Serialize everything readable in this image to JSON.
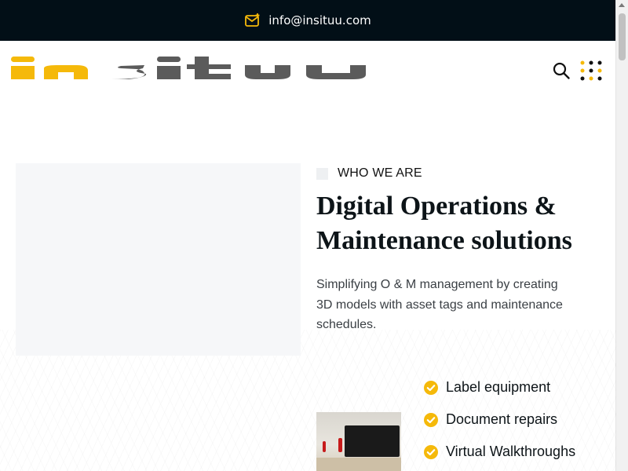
{
  "topbar": {
    "email": "info@insituu.com",
    "icon": "mail-icon"
  },
  "header": {
    "logo_text": "insituu",
    "search_icon": "search-icon",
    "menu_icon": "grid-dots-icon"
  },
  "about": {
    "eyebrow": "WHO WE ARE",
    "headline_line1": "Digital Operations &",
    "headline_line2": "Maintenance solutions",
    "description": "Simplifying O & M management by creating 3D models with asset tags and maintenance schedules.",
    "features": [
      {
        "label": "Label equipment",
        "icon": "check-circle-icon"
      },
      {
        "label": "Document repairs",
        "icon": "check-circle-icon"
      },
      {
        "label": "Virtual Walkthroughs",
        "icon": "check-circle-icon"
      }
    ]
  },
  "colors": {
    "topbar_bg": "#020f17",
    "accent_yellow": "#f5b90a",
    "logo_gray": "#5b5b5b"
  }
}
